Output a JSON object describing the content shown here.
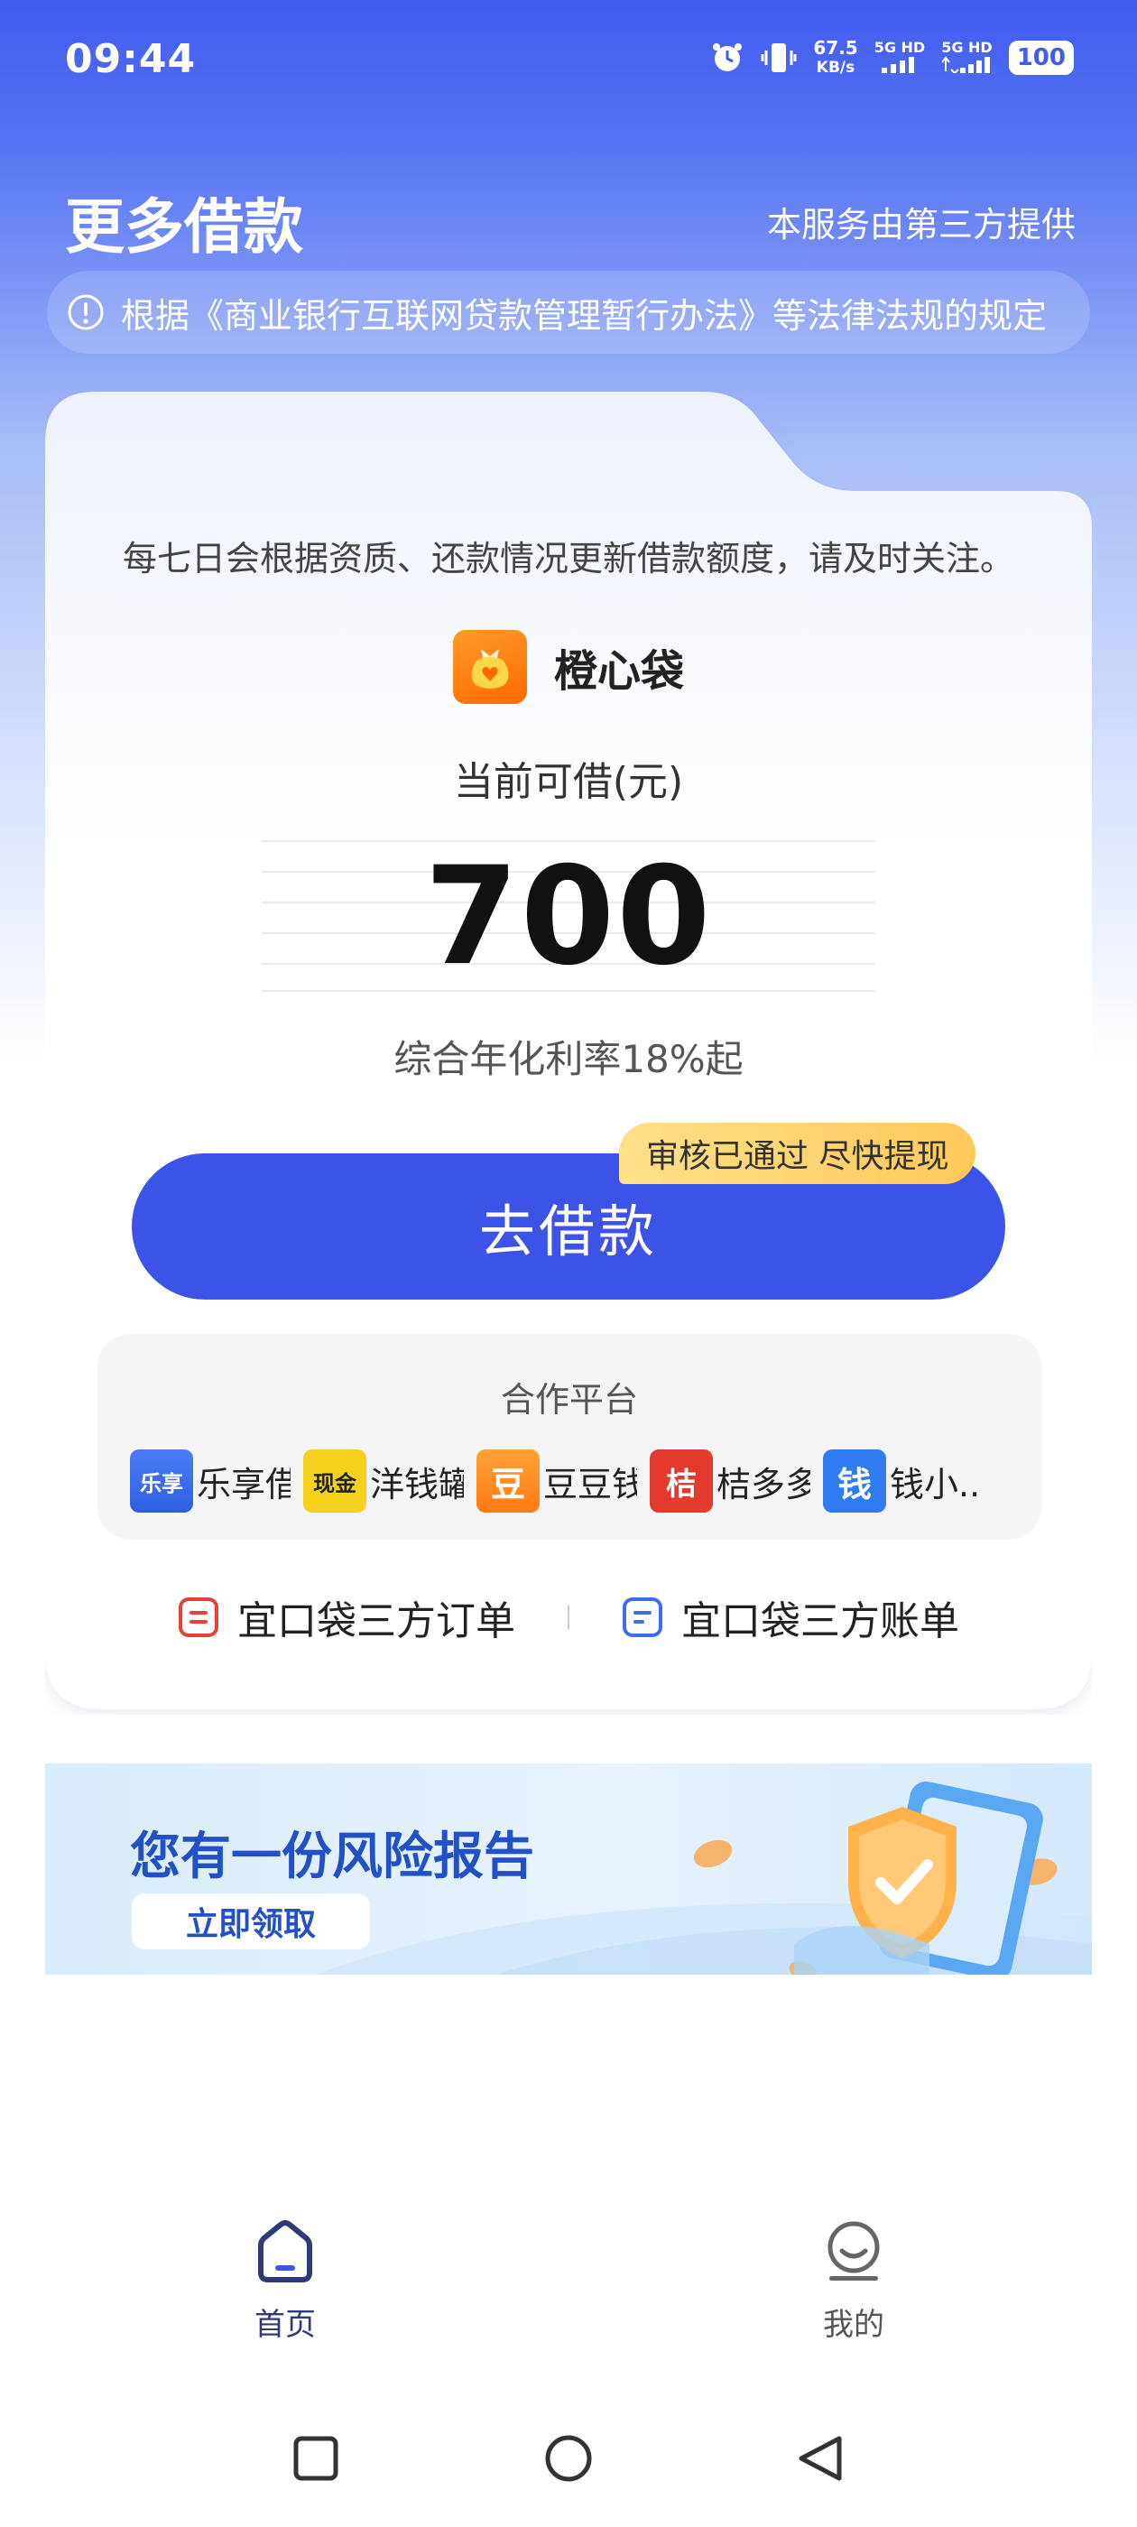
{
  "status_bar": {
    "time": "09:44",
    "net_speed_value": "67.5",
    "net_speed_unit": "KB/s",
    "signal1": "5G HD",
    "signal2": "5G HD",
    "battery": "100"
  },
  "header": {
    "title": "更多借款",
    "provider_note": "本服务由第三方提供",
    "notice": "根据《商业银行互联网贷款管理暂行办法》等法律法规的规定"
  },
  "card": {
    "info": "每七日会根据资质、还款情况更新借款额度，请及时关注。",
    "brand_name": "橙心袋",
    "available_label": "当前可借(元)",
    "amount": "700",
    "rate": "综合年化利率18%起",
    "borrow_button": "去借款",
    "approval_badge": "审核已通过 尽快提现"
  },
  "partners": {
    "title": "合作平台",
    "items": [
      {
        "name": "乐享借",
        "logo_text": "乐享",
        "color": "#3a6ff0"
      },
      {
        "name": "洋钱罐",
        "logo_text": "现金",
        "color": "#f6d21e"
      },
      {
        "name": "豆豆钱",
        "logo_text": "豆",
        "color": "#ff8a1d"
      },
      {
        "name": "桔多多",
        "logo_text": "桔",
        "color": "#e43a2e"
      },
      {
        "name": "钱小...",
        "logo_text": "钱",
        "color": "#2f7cf0"
      }
    ]
  },
  "links": {
    "orders": "宜口袋三方订单",
    "bills": "宜口袋三方账单"
  },
  "banner": {
    "title": "您有一份风险报告",
    "button": "立即领取"
  },
  "tabbar": {
    "home": "首页",
    "mine": "我的",
    "active_color": "#2e3a78",
    "inactive_color": "#555"
  }
}
